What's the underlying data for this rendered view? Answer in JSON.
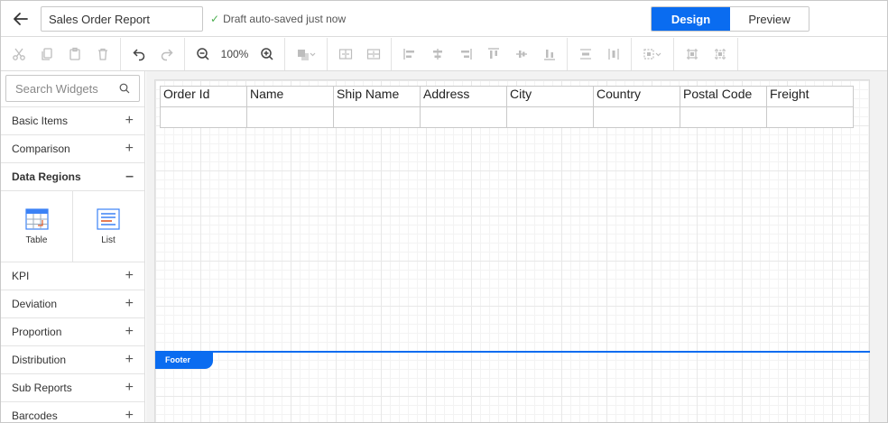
{
  "topbar": {
    "report_title": "Sales Order Report",
    "save_status": "Draft auto-saved just now",
    "modes": [
      "Design",
      "Preview"
    ],
    "active_mode": "Design",
    "accent_color": "#0a6cf0"
  },
  "toolbar": {
    "zoom": "100%",
    "icons": [
      "cut-icon",
      "copy-icon",
      "paste-icon",
      "delete-icon",
      "undo-icon",
      "redo-icon",
      "zoom-out-icon",
      "zoom-in-icon",
      "order-icon",
      "align-icons",
      "distribute-icons",
      "size-icons",
      "group-icons"
    ]
  },
  "sidebar": {
    "search_placeholder": "Search Widgets",
    "categories_top": [
      {
        "label": "Basic Items",
        "toggle": "+"
      },
      {
        "label": "Comparison",
        "toggle": "+"
      },
      {
        "label": "Data Regions",
        "toggle": "–"
      }
    ],
    "widgets": [
      {
        "label": "Table",
        "icon": "table-icon"
      },
      {
        "label": "List",
        "icon": "list-icon"
      }
    ],
    "categories_bottom": [
      {
        "label": "KPI",
        "toggle": "+"
      },
      {
        "label": "Deviation",
        "toggle": "+"
      },
      {
        "label": "Proportion",
        "toggle": "+"
      },
      {
        "label": "Distribution",
        "toggle": "+"
      },
      {
        "label": "Sub Reports",
        "toggle": "+"
      },
      {
        "label": "Barcodes",
        "toggle": "+"
      }
    ]
  },
  "report": {
    "columns": [
      "Order Id",
      "Name",
      "Ship Name",
      "Address",
      "City",
      "Country",
      "Postal Code",
      "Freight"
    ],
    "footer_label": "Footer"
  }
}
